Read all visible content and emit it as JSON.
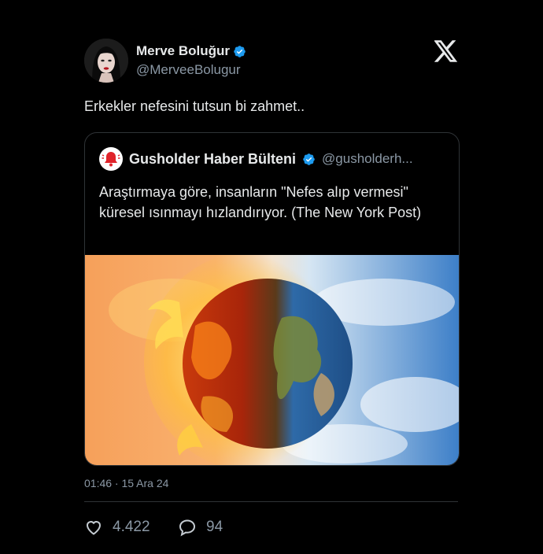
{
  "author": {
    "name": "Merve Boluğur",
    "handle": "@MerveeBolugur",
    "avatar_icon": "profile-photo-woman"
  },
  "tweet": {
    "text": "Erkekler nefesini tutsun bi zahmet..",
    "timestamp": "01:46 · 15 Ara 24",
    "likes": "4.422",
    "replies": "94"
  },
  "quoted": {
    "name": "Gusholder Haber Bülteni",
    "handle": "@gusholderh...",
    "avatar_icon": "red-bell-icon",
    "text": "Araştırmaya göre, insanların \"Nefes alıp vermesi\" küresel ısınmayı hızlandırıyor. (The New York Post)",
    "image_icon": "earth-half-burning-half-clouds"
  },
  "colors": {
    "background": "#000000",
    "verified": "#1d9bf0",
    "text_primary": "#e7e9ea",
    "text_secondary": "#8b98a5",
    "border": "#2f3336"
  }
}
